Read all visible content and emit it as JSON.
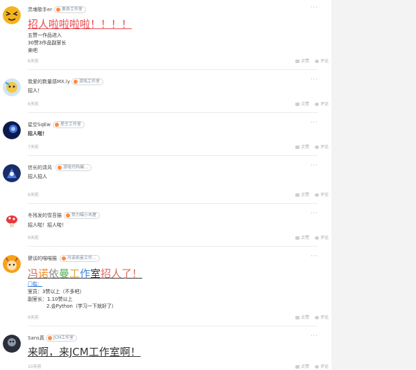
{
  "actions": {
    "like_label": "点赞",
    "comment_label": "评论",
    "more_label": "···"
  },
  "posts": [
    {
      "username": "灵魂歌手er",
      "badge": "奥奇工作室",
      "headline": "招人啦啦啦啦！！！！",
      "lines": [
        "五赞一作品进入",
        "30赞3作品副室长",
        "来吧"
      ],
      "time": "6天前"
    },
    {
      "username": "我爱的数量感MX.ly",
      "badge": "游戏工作室",
      "lines": [
        "招人！"
      ],
      "time": "6天前"
    },
    {
      "username": "星空SqEw",
      "badge": "星空工作室",
      "lines": [
        "招人啦！"
      ],
      "time": "7天前"
    },
    {
      "username": "信长的清风",
      "badge": "游戏代码编…",
      "lines": [
        "招人招人"
      ],
      "time": "9天前"
    },
    {
      "username": "冬残发的雪苔猫",
      "badge": "努力喵小木屋",
      "lines": [
        "招人啦！招人啦！"
      ],
      "time": "9天前"
    },
    {
      "username": "健谈的喵喵猫",
      "badge": "冯诺依曼工作…",
      "headline_parts": [
        {
          "text": "冯",
          "color": "#e0655a"
        },
        {
          "text": "诺",
          "color": "#f08a2a"
        },
        {
          "text": "依",
          "color": "#8a8a8a"
        },
        {
          "text": "曼",
          "color": "#4cae4c"
        },
        {
          "text": "工",
          "color": "#e0a030"
        },
        {
          "text": "作",
          "color": "#3a8ad8"
        },
        {
          "text": "室",
          "color": "#333333"
        },
        {
          "text": "招人了！",
          "color": "#e0655a"
        }
      ],
      "link": "门槛：",
      "lines": [
        "室员：3赞以上（不多吧）",
        "副室长：1.10赞以上",
        "2.会Python（学习一下就好了）"
      ],
      "time": "9天前"
    },
    {
      "username": "Sans真",
      "badge": "JCM工作室",
      "headline": "来啊，来JCM工作室啊！",
      "lines": [],
      "time": "10天前"
    }
  ],
  "colors": {
    "headline_red": "#e8484f",
    "link_blue": "#3a7bd5",
    "badge_dot": "#ff8a3d"
  }
}
